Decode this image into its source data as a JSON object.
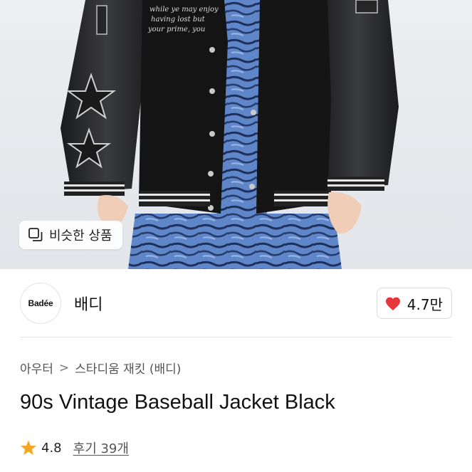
{
  "photo": {
    "alt": "product-image",
    "jacket_script": [
      "while ye may enjoy",
      "having lost but",
      "your prime, you"
    ]
  },
  "similar_button": {
    "label": "비슷한 상품",
    "icon": "similar-items-icon"
  },
  "brand": {
    "logo_text": "Badée",
    "name": "배디"
  },
  "like": {
    "count": "4.7만",
    "icon": "heart-icon",
    "color": "#e8343b"
  },
  "breadcrumb": {
    "category": "아우터",
    "separator": ">",
    "subcategory": "스타디움 재킷 (배디)"
  },
  "product": {
    "title": "90s Vintage Baseball Jacket Black"
  },
  "rating": {
    "score": "4.8",
    "reviews": "후기 39개",
    "icon": "star-icon",
    "star_color": "#f5a623"
  }
}
